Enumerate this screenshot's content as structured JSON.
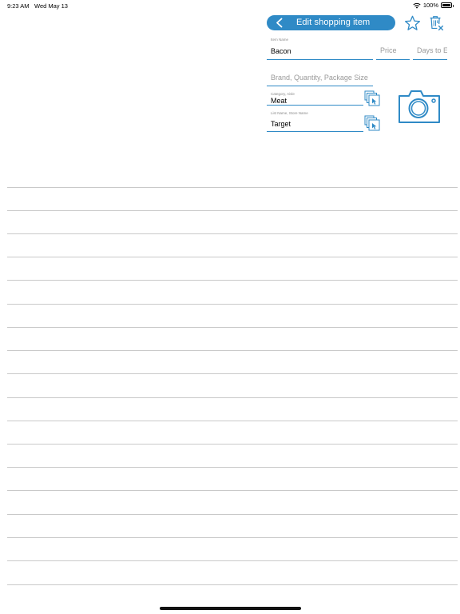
{
  "status_bar": {
    "time": "9:23 AM",
    "date": "Wed May 13",
    "battery": "100%"
  },
  "header": {
    "title": "Edit shopping item"
  },
  "form": {
    "item_name": {
      "label": "Item Name",
      "value": "Bacon"
    },
    "price": {
      "placeholder": "Price"
    },
    "days_to_expire": {
      "placeholder": "Days to Expire"
    },
    "brand": {
      "placeholder": "Brand, Quantity, Package Size"
    },
    "category": {
      "label": "Category, Aisle",
      "value": "Meat"
    },
    "list_name": {
      "label": "List Name, Store Name",
      "value": "Target"
    }
  },
  "colors": {
    "accent": "#2f8ac6",
    "line": "#c9c9c9"
  }
}
